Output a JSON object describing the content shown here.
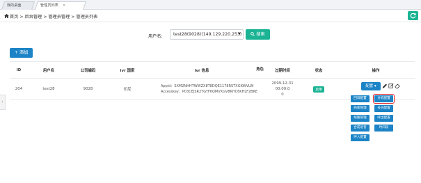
{
  "tabs": [
    {
      "label": "我的桌面"
    },
    {
      "label": "管理员列表",
      "close": "×"
    }
  ],
  "breadcrumb": {
    "text": "首页 > 后台管理 > 管理员管理 > 管理员列表"
  },
  "search": {
    "label": "用户名:",
    "selected_value": "test28(9028)(149.129.220.253)",
    "button_label": "搜索"
  },
  "add_button": {
    "label": "+ 添加"
  },
  "table": {
    "headers": [
      "ID",
      "用户名",
      "公司编码",
      "ivr 国家",
      "ivr 信息",
      "角色",
      "过期时间",
      "状态",
      "操作"
    ],
    "rows": [
      {
        "id": "204",
        "username": "test28",
        "company_code": "9028",
        "ivr_country": "印尼",
        "ivr_info_line1": "Appid：SXM2NHHTWWZX8T8DQE1178RSTXGKWVLW",
        "ivr_info_line2": "Accesskey：P03CEJSR2YGYF6QMVXGV8KHC6KHLF2BKE",
        "role": "",
        "expire_line1": "2099-12-31 00:00:0",
        "expire_line2": "0",
        "status": "启用"
      }
    ]
  },
  "actions": {
    "config_button": "配置",
    "dropdown": [
      "回调配置",
      "分机配置",
      "商家管理",
      "号码配置",
      "线路管理",
      "呼出配置",
      "合成语音",
      "时间段",
      "呼入配置"
    ]
  },
  "colors": {
    "primary": "#1c84c6",
    "success": "#1ab394",
    "highlight_border": "#e0282c"
  }
}
